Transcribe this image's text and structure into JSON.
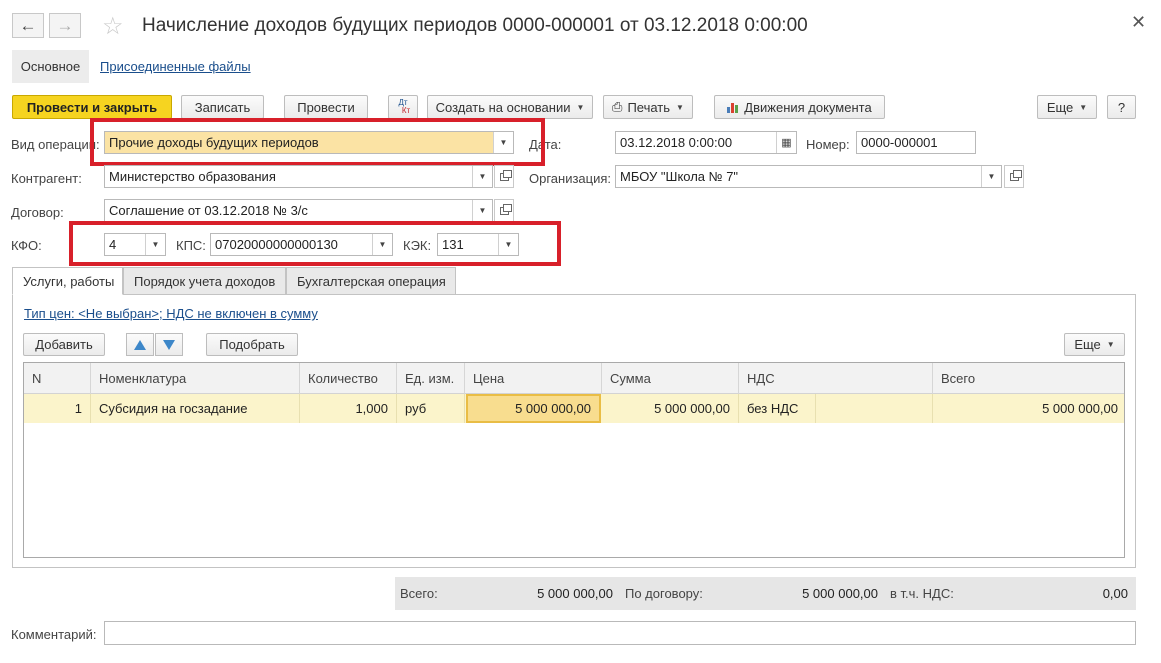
{
  "window": {
    "title": "Начисление доходов будущих периодов 0000-000001 от 03.12.2018 0:00:00",
    "nav_back_icon": "arrow-left-icon",
    "nav_forward_icon": "arrow-right-icon",
    "favorite_icon": "star-icon",
    "close_icon": "close-icon"
  },
  "sections": {
    "main_label": "Основное",
    "attachments_label": "Присоединенные файлы"
  },
  "toolbar": {
    "post_close": "Провести и закрыть",
    "save": "Записать",
    "post": "Провести",
    "dtkt_top": "Дт",
    "dtkt_bottom": "Кт",
    "create_based": "Создать на основании",
    "print": "Печать",
    "movements": "Движения документа",
    "more": "Еще",
    "help": "?"
  },
  "form": {
    "operation_label": "Вид операции:",
    "operation_value": "Прочие доходы будущих периодов",
    "date_label": "Дата:",
    "date_value": "03.12.2018  0:00:00",
    "number_label": "Номер:",
    "number_value": "0000-000001",
    "counterparty_label": "Контрагент:",
    "counterparty_value": "Министерство образования",
    "organization_label": "Организация:",
    "organization_value": "МБОУ \"Школа № 7\"",
    "contract_label": "Договор:",
    "contract_value": "Соглашение от 03.12.2018 № 3/с",
    "kfo_label": "КФО:",
    "kfo_value": "4",
    "kps_label": "КПС:",
    "kps_value": "07020000000000130",
    "kek_label": "КЭК:",
    "kek_value": "131"
  },
  "tabs": [
    {
      "label": "Услуги, работы"
    },
    {
      "label": "Порядок учета доходов"
    },
    {
      "label": "Бухгалтерская операция"
    }
  ],
  "services": {
    "price_type_link": "Тип цен: <Не выбран>; НДС не включен в сумму",
    "add_button": "Добавить",
    "pick_button": "Подобрать",
    "more_button": "Еще",
    "columns": [
      "N",
      "Номенклатура",
      "Количество",
      "Ед. изм.",
      "Цена",
      "Сумма",
      "НДС",
      "Всего"
    ],
    "rows": [
      {
        "n": "1",
        "item": "Субсидия на госзадание",
        "qty": "1,000",
        "unit": "руб",
        "price": "5 000 000,00",
        "sum": "5 000 000,00",
        "vat": "без НДС",
        "total": "5 000 000,00"
      }
    ]
  },
  "totals": {
    "total_label": "Всего:",
    "total_value": "5 000 000,00",
    "contract_label": "По договору:",
    "contract_value": "5 000 000,00",
    "vat_label": "в т.ч. НДС:",
    "vat_value": "0,00"
  },
  "comment": {
    "label": "Комментарий:",
    "value": ""
  },
  "colors": {
    "accent_yellow": "#f6d420",
    "highlight_red": "#d8202a",
    "row_highlight": "#fbf4cb"
  }
}
